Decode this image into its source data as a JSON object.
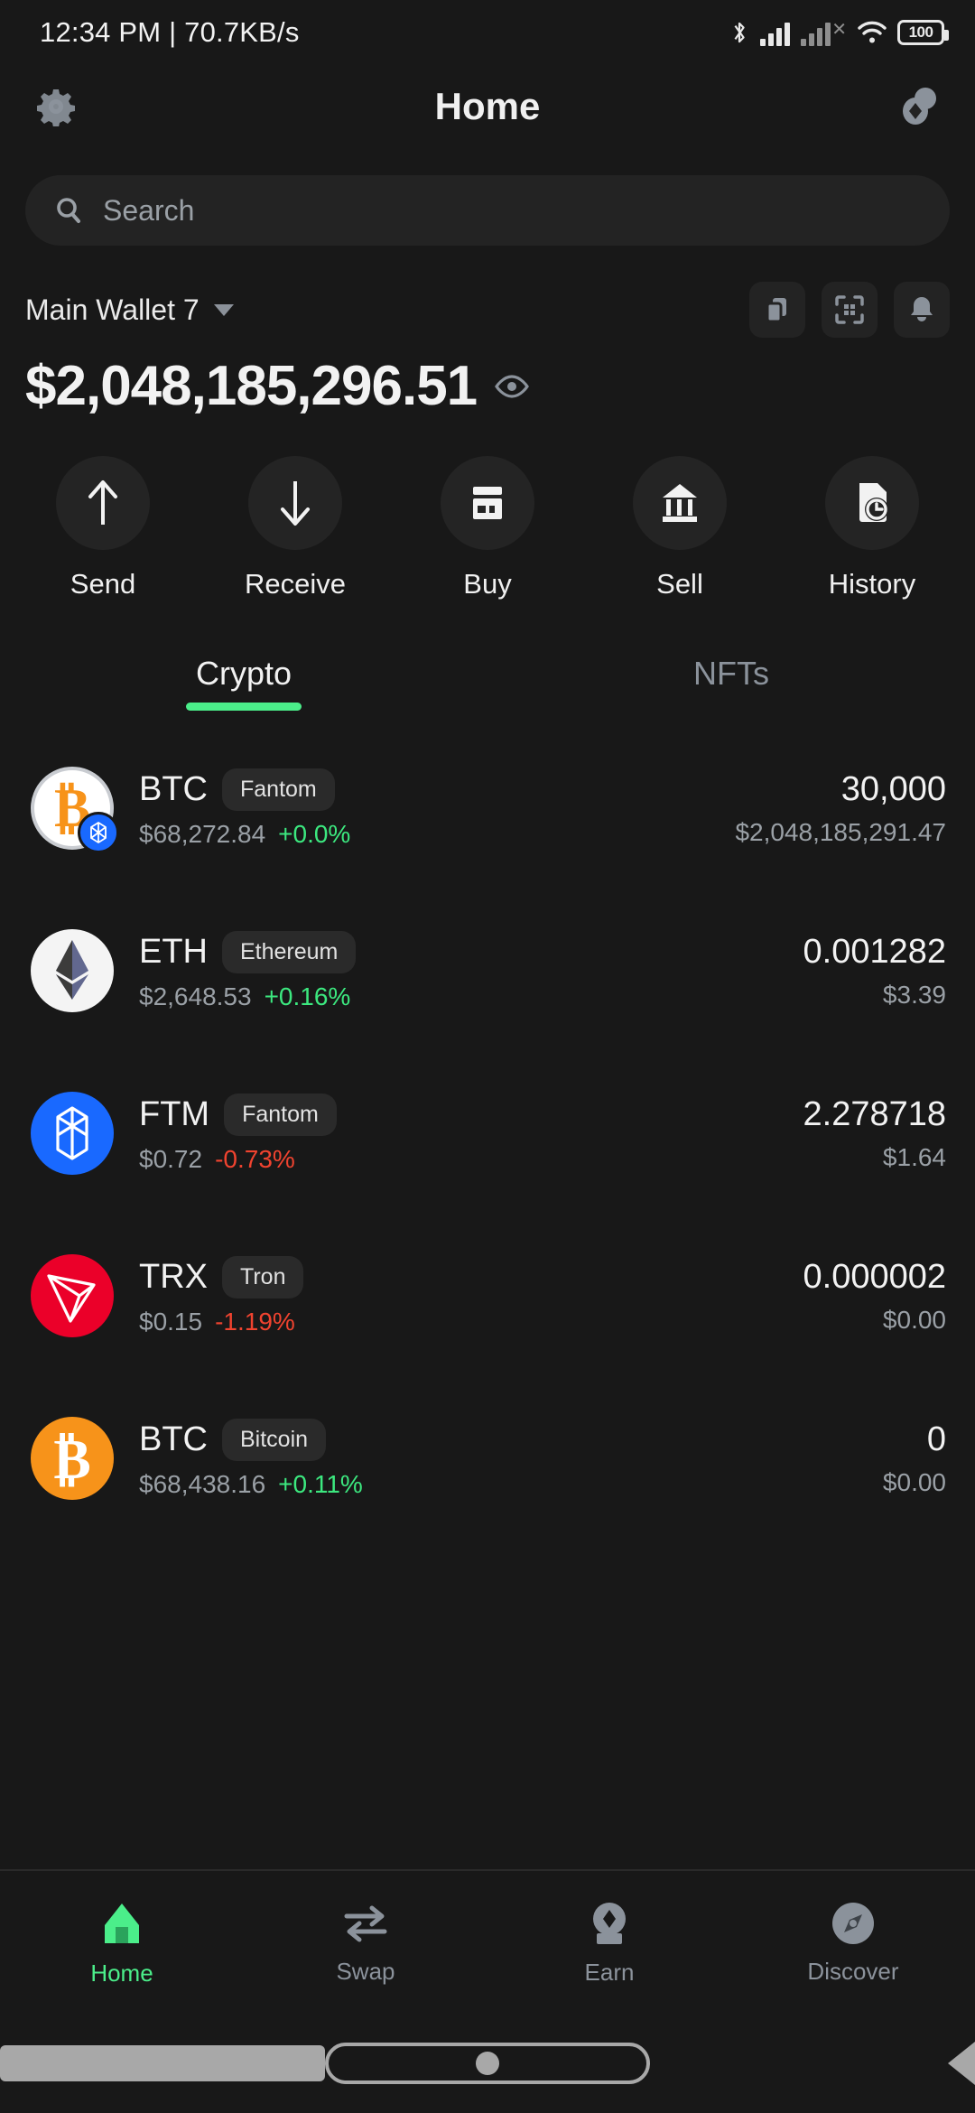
{
  "statusbar": {
    "time_and_net": "12:34 PM | 70.7KB/s",
    "bluetooth_icon": "bluetooth-icon",
    "signal_icon": "signal-bars-icon",
    "signal2_icon": "signal-bars-no-service-icon",
    "wifi_icon": "wifi-icon",
    "battery_level": "100"
  },
  "appbar": {
    "settings_icon": "gear-icon",
    "title": "Home",
    "brand_icon": "brand-mark-icon"
  },
  "search": {
    "placeholder": "Search",
    "icon": "search-icon",
    "value": ""
  },
  "wallet": {
    "name": "Main Wallet 7",
    "dropdown_icon": "chevron-down-icon",
    "actions": [
      {
        "name": "copy-address-button",
        "icon": "copy-icon"
      },
      {
        "name": "scan-qr-button",
        "icon": "qr-scan-icon"
      },
      {
        "name": "notifications-button",
        "icon": "bell-icon"
      }
    ],
    "balance": "$2,048,185,296.51",
    "visibility_icon": "eye-icon"
  },
  "quick_actions": [
    {
      "label": "Send",
      "icon": "arrow-up-icon"
    },
    {
      "label": "Receive",
      "icon": "arrow-down-icon"
    },
    {
      "label": "Buy",
      "icon": "credit-card-icon"
    },
    {
      "label": "Sell",
      "icon": "bank-icon"
    },
    {
      "label": "History",
      "icon": "document-clock-icon"
    }
  ],
  "tabs": [
    {
      "label": "Crypto",
      "active": true
    },
    {
      "label": "NFTs",
      "active": false
    }
  ],
  "tokens": [
    {
      "symbol": "BTC",
      "chain": "Fantom",
      "price": "$68,272.84",
      "change": "+0.0%",
      "direction": "up",
      "amount": "30,000",
      "value": "$2,048,185,291.47",
      "icon": "bitcoin-icon",
      "network_badge": "fantom-network-badge"
    },
    {
      "symbol": "ETH",
      "chain": "Ethereum",
      "price": "$2,648.53",
      "change": "+0.16%",
      "direction": "up",
      "amount": "0.001282",
      "value": "$3.39",
      "icon": "ethereum-icon",
      "network_badge": null
    },
    {
      "symbol": "FTM",
      "chain": "Fantom",
      "price": "$0.72",
      "change": "-0.73%",
      "direction": "down",
      "amount": "2.278718",
      "value": "$1.64",
      "icon": "fantom-icon",
      "network_badge": null
    },
    {
      "symbol": "TRX",
      "chain": "Tron",
      "price": "$0.15",
      "change": "-1.19%",
      "direction": "down",
      "amount": "0.000002",
      "value": "$0.00",
      "icon": "tron-icon",
      "network_badge": null
    },
    {
      "symbol": "BTC",
      "chain": "Bitcoin",
      "price": "$68,438.16",
      "change": "+0.11%",
      "direction": "up",
      "amount": "0",
      "value": "$0.00",
      "icon": "bitcoin-icon",
      "network_badge": null
    }
  ],
  "bottom_nav": [
    {
      "label": "Home",
      "icon": "home-icon",
      "active": true
    },
    {
      "label": "Swap",
      "icon": "swap-icon",
      "active": false
    },
    {
      "label": "Earn",
      "icon": "earn-gem-icon",
      "active": false
    },
    {
      "label": "Discover",
      "icon": "compass-icon",
      "active": false
    }
  ],
  "system_nav": [
    {
      "name": "recents-button",
      "icon": "square-icon"
    },
    {
      "name": "home-button",
      "icon": "circle-icon"
    },
    {
      "name": "back-button",
      "icon": "triangle-left-icon"
    }
  ],
  "colors": {
    "background": "#181818",
    "surface": "#232323",
    "accent_green": "#4bee8a",
    "up_green": "#3ce87f",
    "down_red": "#f0432f",
    "muted": "#9aa0a6"
  }
}
